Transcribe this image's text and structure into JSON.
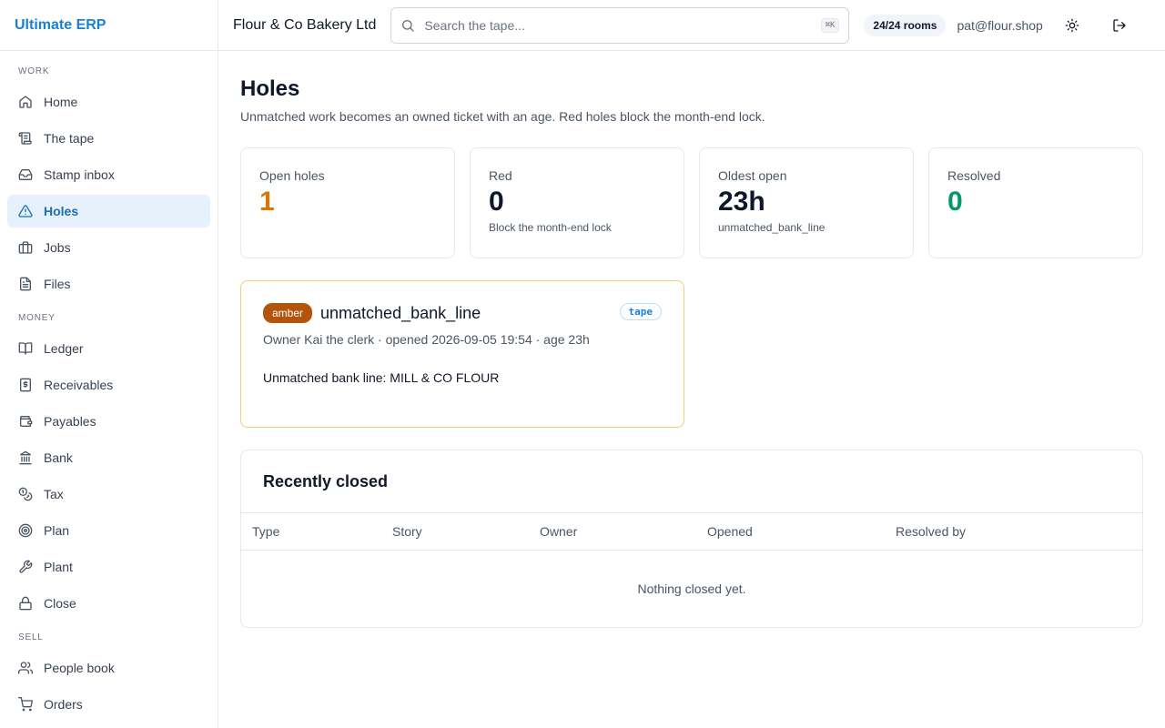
{
  "app": {
    "name": "Ultimate ERP"
  },
  "sidebar": {
    "sections": [
      {
        "label": "WORK",
        "items": [
          {
            "label": "Home",
            "icon": "home-icon"
          },
          {
            "label": "The tape",
            "icon": "scroll-icon"
          },
          {
            "label": "Stamp inbox",
            "icon": "inbox-icon"
          },
          {
            "label": "Holes",
            "icon": "warning-icon",
            "active": true
          },
          {
            "label": "Jobs",
            "icon": "briefcase-icon"
          },
          {
            "label": "Files",
            "icon": "file-icon"
          }
        ]
      },
      {
        "label": "MONEY",
        "items": [
          {
            "label": "Ledger",
            "icon": "book-open-icon"
          },
          {
            "label": "Receivables",
            "icon": "receipt-dollar-icon"
          },
          {
            "label": "Payables",
            "icon": "wallet-icon"
          },
          {
            "label": "Bank",
            "icon": "bank-icon"
          },
          {
            "label": "Tax",
            "icon": "coins-icon"
          },
          {
            "label": "Plan",
            "icon": "target-icon"
          },
          {
            "label": "Plant",
            "icon": "wrench-icon"
          },
          {
            "label": "Close",
            "icon": "lock-icon"
          }
        ]
      },
      {
        "label": "SELL",
        "items": [
          {
            "label": "People book",
            "icon": "users-icon"
          },
          {
            "label": "Orders",
            "icon": "cart-icon"
          }
        ]
      }
    ]
  },
  "topbar": {
    "org": "Flour & Co Bakery Ltd",
    "search_placeholder": "Search the tape...",
    "search_shortcut": "⌘K",
    "rooms": "24/24 rooms",
    "user": "pat@flour.shop"
  },
  "page": {
    "title": "Holes",
    "subtitle": "Unmatched work becomes an owned ticket with an age. Red holes block the month-end lock."
  },
  "stats": [
    {
      "label": "Open holes",
      "value": "1",
      "hint": "",
      "color": "#d97706"
    },
    {
      "label": "Red",
      "value": "0",
      "hint": "Block the month-end lock",
      "color": "#0f172a"
    },
    {
      "label": "Oldest open",
      "value": "23h",
      "hint": "unmatched_bank_line",
      "color": "#0f172a"
    },
    {
      "label": "Resolved",
      "value": "0",
      "hint": "",
      "color": "#059669"
    }
  ],
  "hole": {
    "severity": "amber",
    "title": "unmatched_bank_line",
    "source": "tape",
    "meta": "Owner Kai the clerk · opened 2026-09-05 19:54 · age 23h",
    "description": "Unmatched bank line: MILL & CO FLOUR"
  },
  "recently_closed": {
    "title": "Recently closed",
    "columns": [
      "Type",
      "Story",
      "Owner",
      "Opened",
      "Resolved by"
    ],
    "rows": [],
    "empty_text": "Nothing closed yet."
  }
}
